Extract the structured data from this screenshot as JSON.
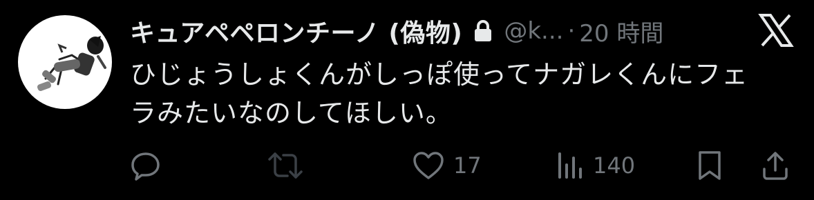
{
  "tweet": {
    "display_name": "キュアペペロンチーノ (偽物)",
    "handle": "@k...",
    "separator": "·",
    "timestamp": "20 時間",
    "text": "ひじょうしょくんがしっぽ使ってナガレくんにフェラみたいなのしてほしい。"
  },
  "icons": {
    "lock": "lock-icon",
    "platform_logo": "x-logo-icon",
    "reply": "reply-icon",
    "repost": "repost-icon",
    "like": "heart-icon",
    "views": "views-icon",
    "bookmark": "bookmark-icon",
    "share": "share-icon"
  },
  "actions": {
    "likes": "17",
    "views": "140"
  },
  "colors": {
    "background": "#000000",
    "primary_text": "#e7e9ea",
    "secondary_text": "#71767b",
    "repost_dim": "#3b4046"
  }
}
